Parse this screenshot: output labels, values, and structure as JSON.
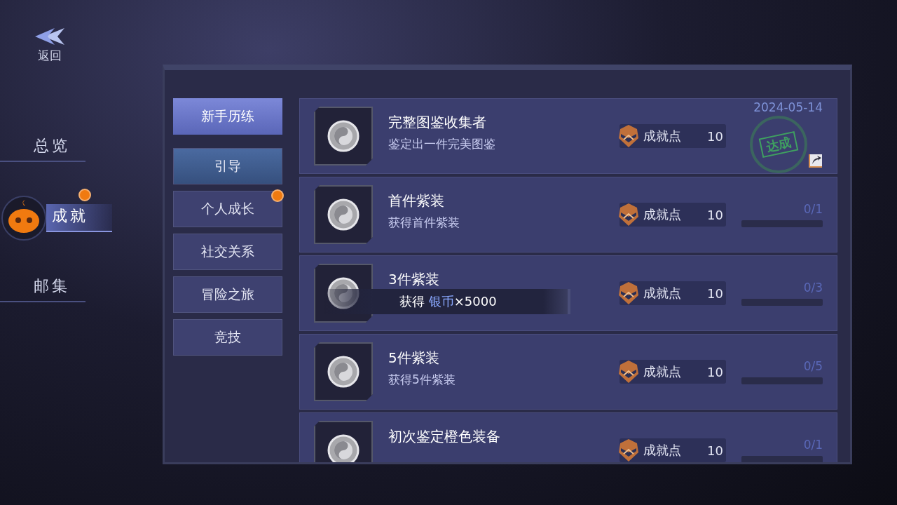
{
  "back_button": {
    "label": "返回"
  },
  "nav": {
    "items": [
      {
        "label": "总览",
        "selected": false,
        "badge": false
      },
      {
        "label": "成就",
        "selected": true,
        "badge": true
      },
      {
        "label": "邮集",
        "selected": false,
        "badge": false
      }
    ]
  },
  "category": {
    "header": "新手历练",
    "tabs": [
      {
        "label": "引导",
        "selected": true,
        "badge": false
      },
      {
        "label": "个人成长",
        "selected": false,
        "badge": true
      },
      {
        "label": "社交关系",
        "selected": false,
        "badge": false
      },
      {
        "label": "冒险之旅",
        "selected": false,
        "badge": false
      },
      {
        "label": "竞技",
        "selected": false,
        "badge": false
      }
    ]
  },
  "achievements": [
    {
      "title": "完整图鉴收集者",
      "description": "鉴定出一件完美图鉴",
      "points_label": "成就点",
      "points": "10",
      "completed": true,
      "date": "2024-05-14",
      "stamp": "达成"
    },
    {
      "title": "首件紫装",
      "description": "获得首件紫装",
      "points_label": "成就点",
      "points": "10",
      "completed": false,
      "progress": "0/1",
      "level": 0
    },
    {
      "title": "3件紫装",
      "points_label": "成就点",
      "points": "10",
      "completed": false,
      "progress": "0/3",
      "level": 0
    },
    {
      "title": "5件紫装",
      "description": "获得5件紫装",
      "points_label": "成就点",
      "points": "10",
      "completed": false,
      "progress": "0/5",
      "level": 0
    },
    {
      "title": "初次鉴定橙色装备",
      "points_label": "成就点",
      "points": "10",
      "completed": false,
      "progress": "0/1",
      "level": 0
    }
  ],
  "toast": {
    "prefix": "获得",
    "item": "银币",
    "amount": "×5000"
  }
}
